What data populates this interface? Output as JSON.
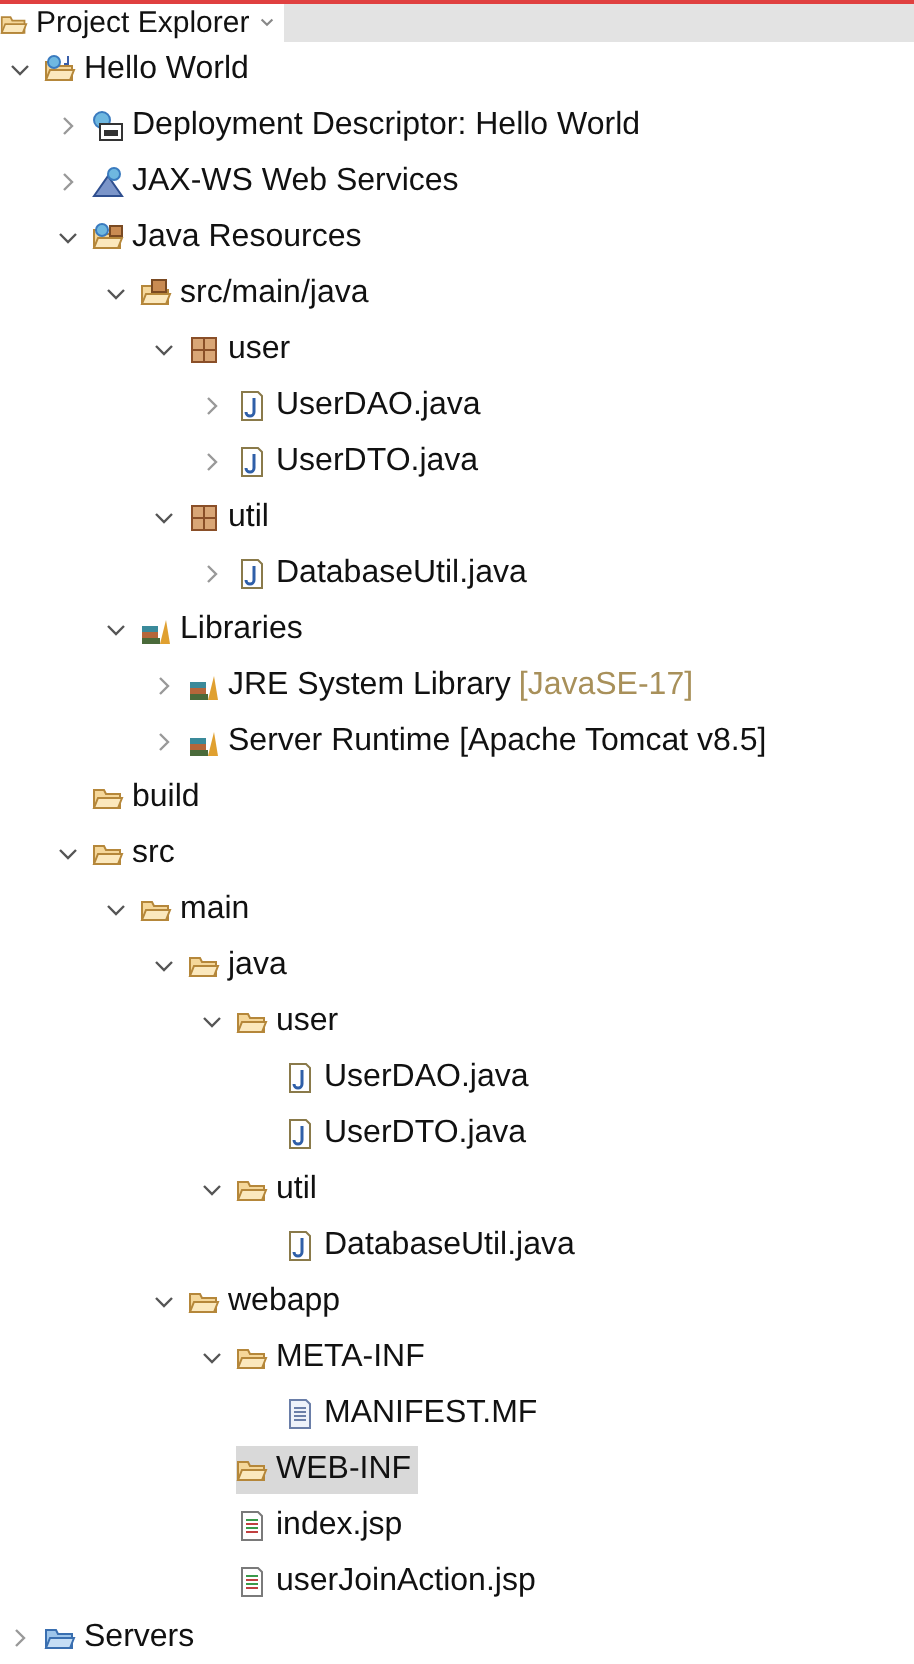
{
  "view_tab": {
    "title": "Project Explorer",
    "selected": true
  },
  "tree": [
    {
      "label": "Hello World",
      "kind": "project",
      "expanded": true,
      "selected": false,
      "children": [
        {
          "label": "Deployment Descriptor: Hello World",
          "kind": "descriptor",
          "expanded": false,
          "selected": false
        },
        {
          "label": "JAX-WS Web Services",
          "kind": "webservices",
          "expanded": false,
          "selected": false
        },
        {
          "label": "Java Resources",
          "kind": "java-resources",
          "expanded": true,
          "selected": false,
          "children": [
            {
              "label": "src/main/java",
              "kind": "source-folder",
              "expanded": true,
              "selected": false,
              "children": [
                {
                  "label": "user",
                  "kind": "package",
                  "expanded": true,
                  "selected": false,
                  "children": [
                    {
                      "label": "UserDAO.java",
                      "kind": "java-file",
                      "expanded": false,
                      "selected": false
                    },
                    {
                      "label": "UserDTO.java",
                      "kind": "java-file",
                      "expanded": false,
                      "selected": false
                    }
                  ]
                },
                {
                  "label": "util",
                  "kind": "package",
                  "expanded": true,
                  "selected": false,
                  "children": [
                    {
                      "label": "DatabaseUtil.java",
                      "kind": "java-file",
                      "expanded": false,
                      "selected": false
                    }
                  ]
                }
              ]
            },
            {
              "label": "Libraries",
              "kind": "libraries",
              "expanded": true,
              "selected": false,
              "children": [
                {
                  "label": "JRE System Library",
                  "decoration": "[JavaSE-17]",
                  "kind": "library",
                  "expanded": false,
                  "selected": false
                },
                {
                  "label": "Server Runtime [Apache Tomcat v8.5]",
                  "kind": "library",
                  "expanded": false,
                  "selected": false
                }
              ]
            }
          ]
        },
        {
          "label": "build",
          "kind": "folder",
          "selected": false
        },
        {
          "label": "src",
          "kind": "folder",
          "expanded": true,
          "selected": false,
          "children": [
            {
              "label": "main",
              "kind": "folder",
              "expanded": true,
              "selected": false,
              "children": [
                {
                  "label": "java",
                  "kind": "folder",
                  "expanded": true,
                  "selected": false,
                  "children": [
                    {
                      "label": "user",
                      "kind": "folder",
                      "expanded": true,
                      "selected": false,
                      "children": [
                        {
                          "label": "UserDAO.java",
                          "kind": "java-file",
                          "selected": false
                        },
                        {
                          "label": "UserDTO.java",
                          "kind": "java-file",
                          "selected": false
                        }
                      ]
                    },
                    {
                      "label": "util",
                      "kind": "folder",
                      "expanded": true,
                      "selected": false,
                      "children": [
                        {
                          "label": "DatabaseUtil.java",
                          "kind": "java-file",
                          "selected": false
                        }
                      ]
                    }
                  ]
                },
                {
                  "label": "webapp",
                  "kind": "folder",
                  "expanded": true,
                  "selected": false,
                  "children": [
                    {
                      "label": "META-INF",
                      "kind": "folder",
                      "expanded": true,
                      "selected": false,
                      "children": [
                        {
                          "label": "MANIFEST.MF",
                          "kind": "text-file",
                          "selected": false
                        }
                      ]
                    },
                    {
                      "label": "WEB-INF",
                      "kind": "folder",
                      "selected": true
                    },
                    {
                      "label": "index.jsp",
                      "kind": "jsp-file",
                      "selected": false
                    },
                    {
                      "label": "userJoinAction.jsp",
                      "kind": "jsp-file",
                      "selected": false
                    }
                  ]
                }
              ]
            }
          ]
        }
      ]
    },
    {
      "label": "Servers",
      "kind": "servers-folder",
      "expanded": false,
      "selected": false
    }
  ]
}
